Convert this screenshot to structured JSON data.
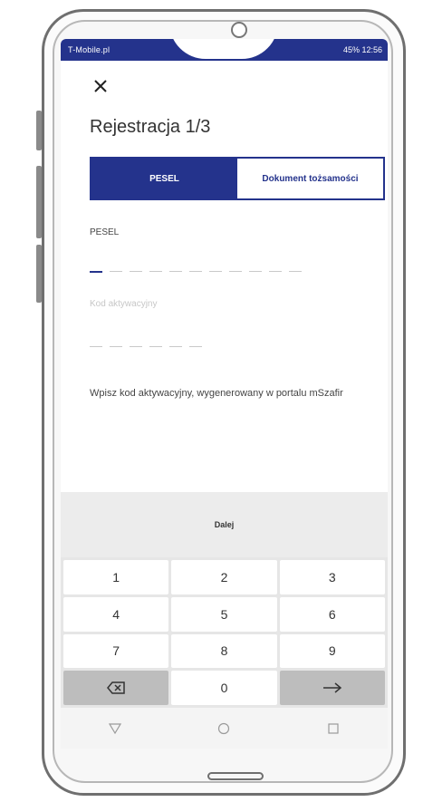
{
  "status_bar": {
    "left": "T-Mobile.pl",
    "right": "45% 12:56"
  },
  "header": {
    "close_icon": "close-icon",
    "title": "Rejestracja 1/3"
  },
  "segment": {
    "options": [
      "PESEL",
      "Dokument tożsamości"
    ],
    "selected": "PESEL"
  },
  "form": {
    "pesel_label": "PESEL",
    "activation_placeholder": "Kod aktywacyjny",
    "info_text": "Wpisz kod aktywacyjny, wygenerowany w portalu mSzafir"
  },
  "actions": {
    "next_label": "Dalej"
  },
  "keypad": {
    "keys": [
      "1",
      "2",
      "3",
      "4",
      "5",
      "6",
      "7",
      "8",
      "9",
      "0"
    ],
    "backspace_icon": "backspace-icon",
    "enter_icon": "arrow-right-icon"
  },
  "navigation": {
    "icons": [
      "back-icon",
      "home-icon",
      "recents-icon"
    ]
  },
  "colors": {
    "accent": "#24338c"
  }
}
